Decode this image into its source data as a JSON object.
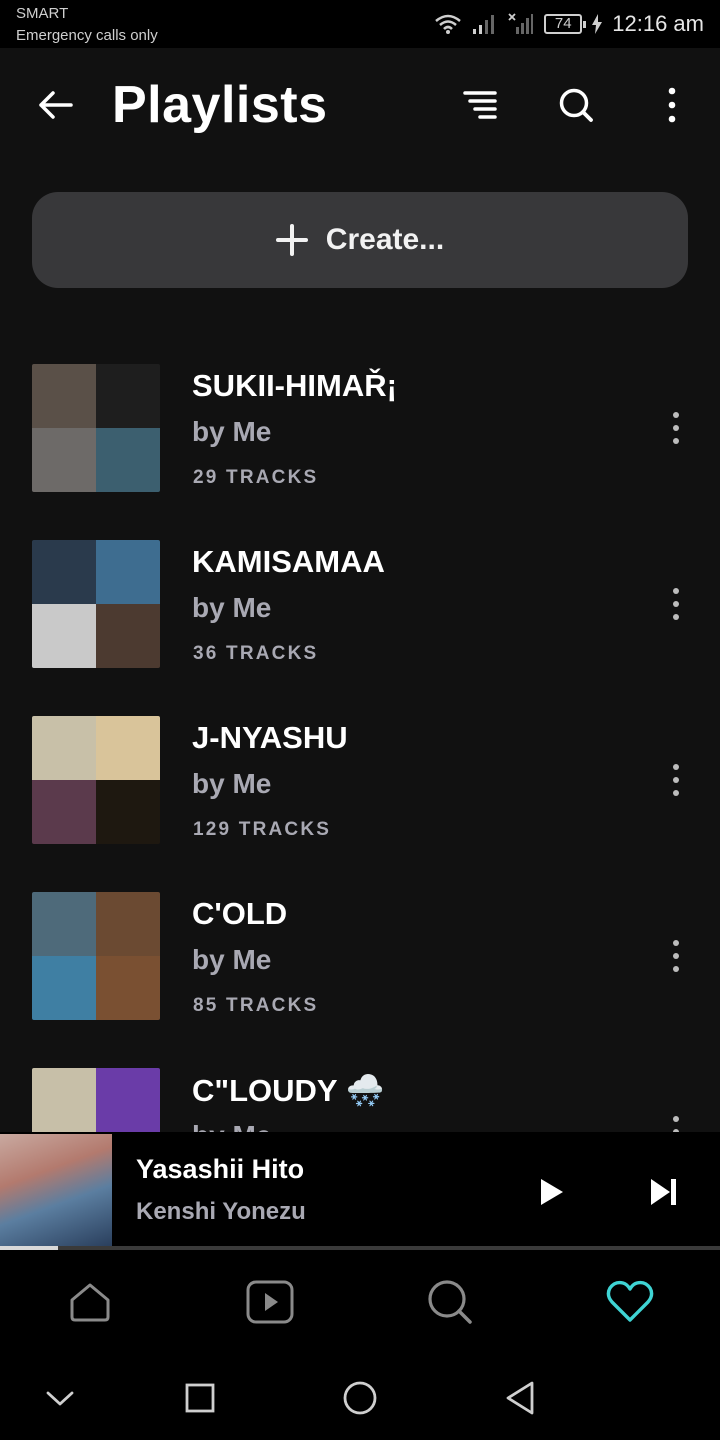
{
  "status_bar": {
    "carrier": "SMART",
    "emergency": "Emergency calls only",
    "battery": "74",
    "time": "12:16 am"
  },
  "header": {
    "title": "Playlists",
    "icons": [
      "back-arrow-icon",
      "sort-icon",
      "search-icon",
      "more-vertical-icon"
    ]
  },
  "create_button": {
    "label": "Create...",
    "icon": "plus-icon"
  },
  "playlists": [
    {
      "title": "SUKII-HIMAŘ¡",
      "owner": "by Me",
      "tracks": "29 TRACKS",
      "art_colors": [
        "#5a5048",
        "#1e1e1e",
        "#6d6a68",
        "#3c5f6f"
      ]
    },
    {
      "title": "KAMISAMAA",
      "owner": "by Me",
      "tracks": "36 TRACKS",
      "art_colors": [
        "#2a3a4c",
        "#3e6d90",
        "#c9c9c9",
        "#4c3a30"
      ]
    },
    {
      "title": "J-NYASHU",
      "owner": "by Me",
      "tracks": "129 TRACKS",
      "art_colors": [
        "#c8c0a8",
        "#d9c49a",
        "#5b3a4c",
        "#1e1810"
      ]
    },
    {
      "title": "C'OLD",
      "owner": "by Me",
      "tracks": "85 TRACKS",
      "art_colors": [
        "#4e6a7a",
        "#6b4a32",
        "#3f7fa3",
        "#7a5032"
      ]
    },
    {
      "title": "C\"LOUDY 🌨️",
      "owner": "by Me",
      "tracks": "",
      "art_colors": [
        "#c7bfa8",
        "#6a3ca8",
        "#9a8f7a",
        "#3b2a6e"
      ]
    }
  ],
  "now_playing": {
    "title": "Yasashii Hito",
    "artist": "Kenshi Yonezu",
    "progress": 0.08
  },
  "bottom_nav": {
    "items": [
      "home-icon",
      "video-icon",
      "search-icon",
      "heart-icon"
    ],
    "active": "heart-icon",
    "active_color": "#3fd4d4"
  },
  "system_nav": [
    "chevron-down-icon",
    "recents-square-icon",
    "home-circle-icon",
    "back-triangle-icon"
  ]
}
